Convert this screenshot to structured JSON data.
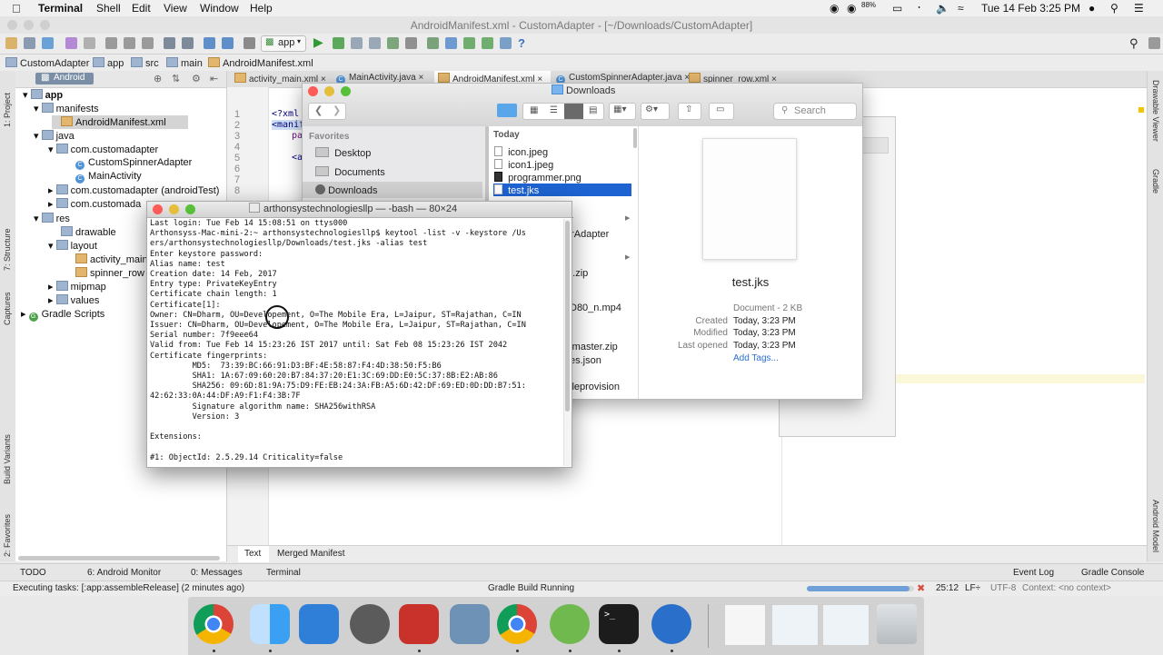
{
  "menubar": {
    "app": "Terminal",
    "items": [
      "Shell",
      "Edit",
      "View",
      "Window",
      "Help"
    ],
    "battery": "88%",
    "datetime": "Tue 14 Feb  3:25 PM"
  },
  "ide": {
    "title": "AndroidManifest.xml - CustomAdapter - [~/Downloads/CustomAdapter]",
    "toolbar_module": "app",
    "breadcrumbs": [
      "CustomAdapter",
      "app",
      "src",
      "main",
      "AndroidManifest.xml"
    ],
    "project_view": "Android",
    "tree": [
      {
        "label": "app",
        "indent": 0
      },
      {
        "label": "manifests",
        "indent": 1
      },
      {
        "label": "AndroidManifest.xml",
        "indent": 2
      },
      {
        "label": "java",
        "indent": 1
      },
      {
        "label": "com.customadapter",
        "indent": 2
      },
      {
        "label": "CustomSpinnerAdapter",
        "indent": 3
      },
      {
        "label": "MainActivity",
        "indent": 3
      },
      {
        "label": "com.customadapter (androidTest)",
        "indent": 2
      },
      {
        "label": "com.customada",
        "indent": 2
      },
      {
        "label": "res",
        "indent": 1
      },
      {
        "label": "drawable",
        "indent": 2
      },
      {
        "label": "layout",
        "indent": 2
      },
      {
        "label": "activity_main",
        "indent": 3
      },
      {
        "label": "spinner_row",
        "indent": 3
      },
      {
        "label": "mipmap",
        "indent": 2
      },
      {
        "label": "values",
        "indent": 2
      },
      {
        "label": "Gradle Scripts",
        "indent": 0
      }
    ],
    "editor_tabs": [
      "activity_main.xml",
      "MainActivity.java",
      "AndroidManifest.xml",
      "CustomSpinnerAdapter.java",
      "spinner_row.xml"
    ],
    "line_numbers": [
      "1",
      "2",
      "3",
      "4",
      "5",
      "6",
      "7",
      "8"
    ],
    "code_fragments": [
      "<?xml",
      "<manif",
      "pa",
      "<a"
    ],
    "bottom_tabs": [
      "Text",
      "Merged Manifest"
    ],
    "tool_windows": [
      "TODO",
      "6: Android Monitor",
      "0: Messages",
      "Terminal"
    ],
    "tool_windows_right": [
      "Event Log",
      "Gradle Console"
    ],
    "left_strip": [
      "1: Project",
      "7: Structure",
      "Captures",
      "Build Variants",
      "2: Favorites"
    ],
    "right_strip": [
      "Drawable Viewer",
      "Gradle",
      "Android Model"
    ],
    "status": {
      "left": "Executing tasks: [:app:assembleRelease] (2 minutes ago)",
      "center": "Gradle Build Running",
      "pos": "25:12",
      "lf": "LF÷",
      "enc": "UTF-8",
      "context": "Context: <no context>"
    }
  },
  "finder": {
    "title": "Downloads",
    "search_placeholder": "Search",
    "favorites_header": "Favorites",
    "favorites": [
      "Desktop",
      "Documents",
      "Downloads"
    ],
    "today_header": "Today",
    "files": [
      "icon.jpeg",
      "icon1.jpeg",
      "programmer.png",
      "test.jks"
    ],
    "partial_files": [
      "er",
      "erAdapter",
      ".9.zip",
      "D80_n.mp4",
      "-master.zip",
      "es.json",
      "ileprovision",
      "ip"
    ],
    "preview": {
      "name": "test.jks",
      "kind": "Document - 2 KB",
      "rows": [
        {
          "label": "Created",
          "value": "Today, 3:23 PM"
        },
        {
          "label": "Modified",
          "value": "Today, 3:23 PM"
        },
        {
          "label": "Last opened",
          "value": "Today, 3:23 PM"
        }
      ],
      "add_tags": "Add Tags..."
    }
  },
  "terminal": {
    "title": "arthonsystechnologiesllp — -bash — 80×24",
    "lines": [
      "Last login: Tue Feb 14 15:08:51 on ttys000",
      "Arthonsyss-Mac-mini-2:~ arthonsystechnologiesllp$ keytool -list -v -keystore /Us",
      "ers/arthonsystechnologiesllp/Downloads/test.jks -alias test",
      "Enter keystore password:",
      "Alias name: test",
      "Creation date: 14 Feb, 2017",
      "Entry type: PrivateKeyEntry",
      "Certificate chain length: 1",
      "Certificate[1]:",
      "Owner: CN=Dharm, OU=Developement, O=The Mobile Era, L=Jaipur, ST=Rajathan, C=IN",
      "Issuer: CN=Dharm, OU=Developement, O=The Mobile Era, L=Jaipur, ST=Rajathan, C=IN",
      "Serial number: 7f9eee64",
      "Valid from: Tue Feb 14 15:23:26 IST 2017 until: Sat Feb 08 15:23:26 IST 2042",
      "Certificate fingerprints:",
      "         MD5:  73:39:BC:66:91:D3:BF:4E:58:87:F4:4D:38:50:F5:B6",
      "         SHA1: 1A:67:09:60:20:B7:84:37:20:E1:3C:69:DD:E0:5C:37:8B:E2:AB:86",
      "         SHA256: 09:6D:81:9A:75:D9:FE:EB:24:3A:FB:A5:6D:42:DF:69:ED:0D:DD:B7:51:",
      "42:62:33:0A:44:DF:A9:F1:F4:3B:7F",
      "         Signature algorithm name: SHA256withRSA",
      "         Version: 3",
      "",
      "Extensions:",
      "",
      "#1: ObjectId: 2.5.29.14 Criticality=false"
    ]
  }
}
